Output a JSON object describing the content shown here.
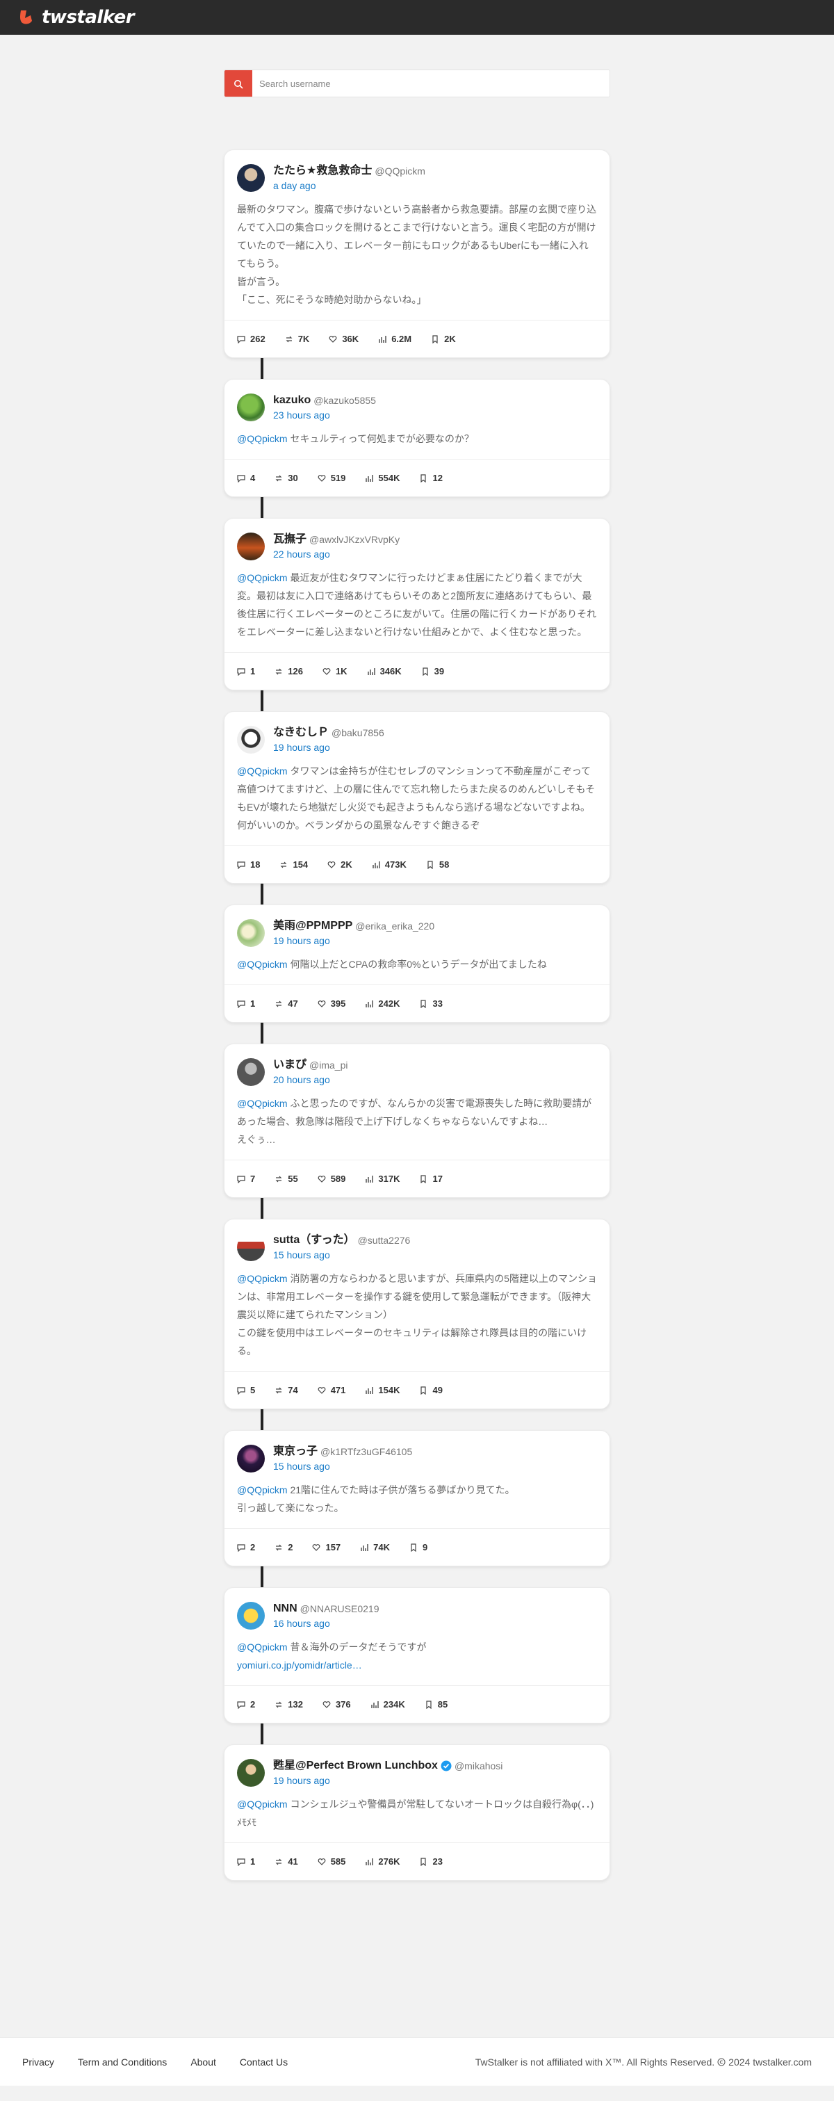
{
  "brand": {
    "name": "twstalker"
  },
  "search": {
    "placeholder": "Search username"
  },
  "tweets": [
    {
      "name": "たたら★救急救命士",
      "handle": "@QQpickm",
      "time": "a day ago",
      "mention": "",
      "text": "最新のタワマン。腹痛で歩けないという高齢者から救急要請。部屋の玄関で座り込んでて入口の集合ロックを開けるとこまで行けないと言う。運良く宅配の方が開けていたので一緒に入り、エレベーター前にもロックがあるもUberにも一緒に入れてもらう。\n皆が言う。\n「ここ、死にそうな時絶対助からないね。」",
      "link": "",
      "stats": [
        "262",
        "7K",
        "36K",
        "6.2M",
        "2K"
      ],
      "verified": false,
      "avatar": "dark"
    },
    {
      "name": "kazuko",
      "handle": "@kazuko5855",
      "time": "23 hours ago",
      "mention": "@QQpickm",
      "text": "セキュルティって何処までが必要なのか？",
      "link": "",
      "stats": [
        "4",
        "30",
        "519",
        "554K",
        "12"
      ],
      "verified": false,
      "avatar": "green"
    },
    {
      "name": "瓦撫子",
      "handle": "@awxlvJKzxVRvpKy",
      "time": "22 hours ago",
      "mention": "@QQpickm",
      "text": "最近友が住むタワマンに行ったけどまぁ住居にたどり着くまでが大変。最初は友に入口で連絡あけてもらいそのあと2箇所友に連絡あけてもらい、最後住居に行くエレベーターのところに友がいて。住居の階に行くカードがありそれをエレベーターに差し込まないと行けない仕組みとかで、よく住むなと思った。",
      "link": "",
      "stats": [
        "1",
        "126",
        "1K",
        "346K",
        "39"
      ],
      "verified": false,
      "avatar": "sunset"
    },
    {
      "name": "なきむしＰ",
      "handle": "@baku7856",
      "time": "19 hours ago",
      "mention": "@QQpickm",
      "text": "タワマンは金持ちが住むセレブのマンションって不動産屋がこぞって高値つけてますけど、上の層に住んでて忘れ物したらまた戻るのめんどいしそもそもEVが壊れたら地獄だし火災でも起きようもんなら逃げる場などないですよね。何がいいのか。ベランダからの風景なんぞすぐ飽きるぞ",
      "link": "",
      "stats": [
        "18",
        "154",
        "2K",
        "473K",
        "58"
      ],
      "verified": false,
      "avatar": "mono"
    },
    {
      "name": "美雨@PPMPPP",
      "handle": "@erika_erika_220",
      "time": "19 hours ago",
      "mention": "@QQpickm",
      "text": "何階以上だとCPAの救命率0%というデータが出てましたね",
      "link": "",
      "stats": [
        "1",
        "47",
        "395",
        "242K",
        "33"
      ],
      "verified": false,
      "avatar": "flower"
    },
    {
      "name": "いまぴ",
      "handle": "@ima_pi",
      "time": "20 hours ago",
      "mention": "@QQpickm",
      "text": "ふと思ったのですが、なんらかの災害で電源喪失した時に救助要請があった場合、救急隊は階段で上げ下げしなくちゃならないんですよね…\nえぐぅ…",
      "link": "",
      "stats": [
        "7",
        "55",
        "589",
        "317K",
        "17"
      ],
      "verified": false,
      "avatar": "gray"
    },
    {
      "name": "sutta（すった）",
      "handle": "@sutta2276",
      "time": "15 hours ago",
      "mention": "@QQpickm",
      "text": "消防署の方ならわかると思いますが、兵庫県内の5階建以上のマンションは、非常用エレベーターを操作する鍵を使用して緊急運転ができます。（阪神大震災以降に建てられたマンション）\nこの鍵を使用中はエレベーターのセキュリティは解除され隊員は目的の階にいける。",
      "link": "",
      "stats": [
        "5",
        "74",
        "471",
        "154K",
        "49"
      ],
      "verified": false,
      "avatar": "train"
    },
    {
      "name": "東京っ子",
      "handle": "@k1RTfz3uGF46105",
      "time": "15 hours ago",
      "mention": "@QQpickm",
      "text": "21階に住んでた時は子供が落ちる夢ばかり見てた。\n引っ越して楽になった。",
      "link": "",
      "stats": [
        "2",
        "2",
        "157",
        "74K",
        "9"
      ],
      "verified": false,
      "avatar": "night"
    },
    {
      "name": "NNN",
      "handle": "@NNARUSE0219",
      "time": "16 hours ago",
      "mention": "@QQpickm",
      "text": "昔＆海外のデータだそうですが",
      "link": "yomiuri.co.jp/yomidr/article…",
      "stats": [
        "2",
        "132",
        "376",
        "234K",
        "85"
      ],
      "verified": false,
      "avatar": "cartoon"
    },
    {
      "name": "甦星@Perfect Brown Lunchbox",
      "handle": "@mikahosi",
      "time": "19 hours ago",
      "mention": "@QQpickm",
      "text": "コンシェルジュや警備員が常駐してないオートロックは自殺行為φ(．．)ﾒﾓﾒﾓ",
      "link": "",
      "stats": [
        "1",
        "41",
        "585",
        "276K",
        "23"
      ],
      "verified": true,
      "avatar": "portrait"
    }
  ],
  "footer": {
    "privacy": "Privacy",
    "terms": "Term and Conditions",
    "about": "About",
    "contact": "Contact Us",
    "copyright": "TwStalker is not affiliated with X™. All Rights Reserved. ",
    "year_site": "2024 twstalker.com"
  },
  "colors": {
    "accent": "#e2483a",
    "link": "#1a7cc8",
    "topbar": "#2b2b2b"
  }
}
